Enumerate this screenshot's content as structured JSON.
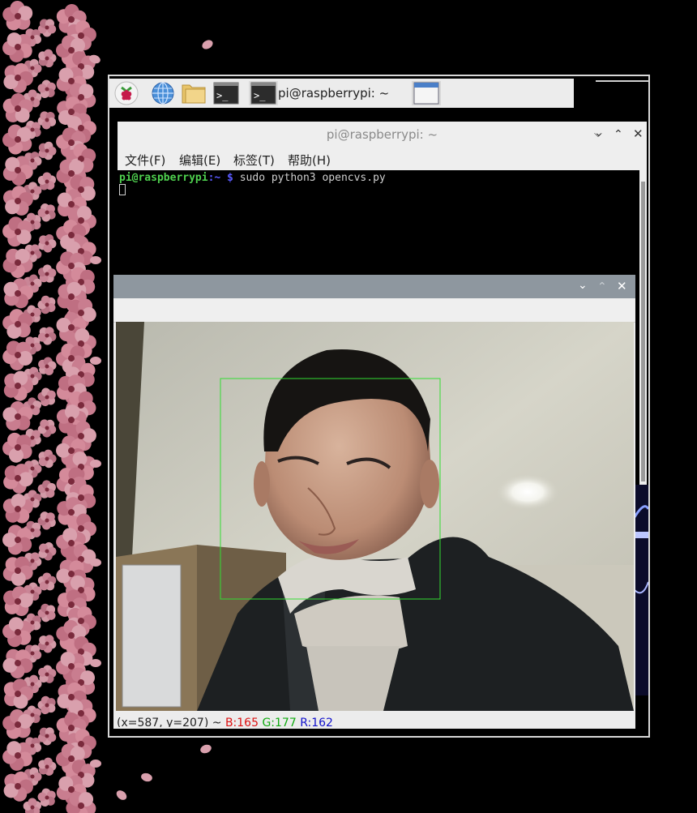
{
  "taskbar": {
    "items": [
      {
        "name": "raspberry-menu-button",
        "icon": "raspberry-icon"
      },
      {
        "name": "web-browser-button",
        "icon": "globe-icon"
      },
      {
        "name": "file-manager-button",
        "icon": "folder-icon"
      },
      {
        "name": "terminal-launcher-button",
        "icon": "terminal-icon"
      }
    ],
    "active_task": "pi@raspberrypi: ~"
  },
  "terminal": {
    "title": "pi@raspberrypi: ~",
    "menu": [
      "文件(F)",
      "编辑(E)",
      "标签(T)",
      "帮助(H)"
    ],
    "prompt_user": "pi@raspberrypi",
    "prompt_path": ":~ $",
    "command": " sudo python3 opencvs.py"
  },
  "opencv_window": {
    "title": "",
    "status": {
      "coords": "(x=587, y=207) ~ ",
      "b": "B:165",
      "g": "G:177",
      "r": "R:162"
    }
  },
  "colors": {
    "face_box": "#33dd33",
    "prompt_user": "#4fd14f",
    "prompt_path": "#5a5aff"
  }
}
